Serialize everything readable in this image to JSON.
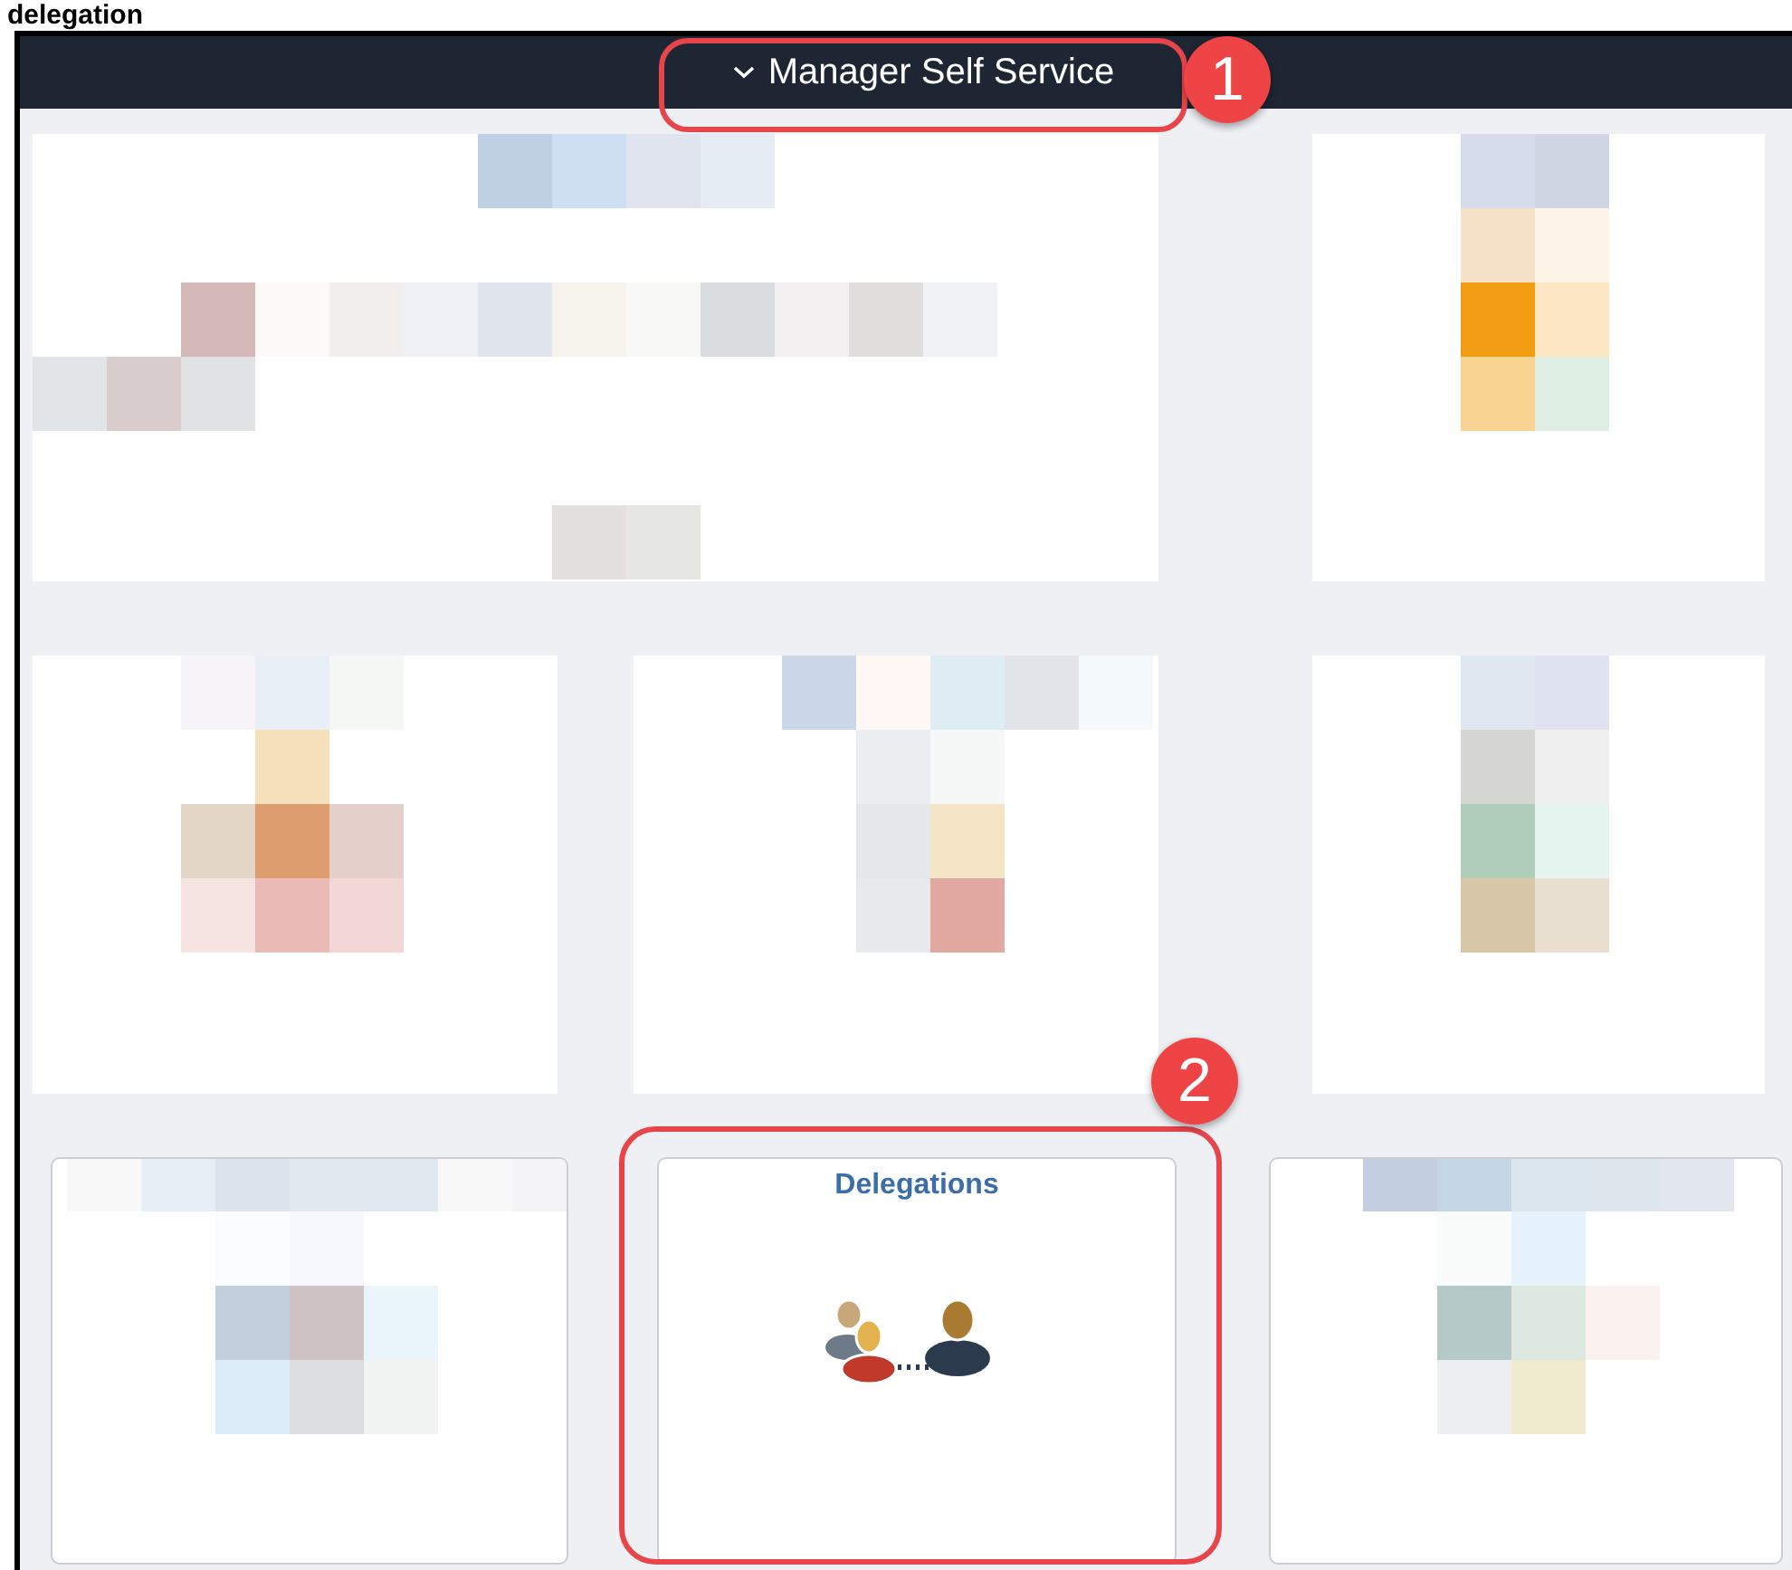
{
  "heading": "delegation",
  "header": {
    "title": "Manager Self Service"
  },
  "tiles": [
    {
      "title": "Delegations"
    }
  ],
  "callouts": [
    {
      "number": "1"
    },
    {
      "number": "2"
    }
  ]
}
